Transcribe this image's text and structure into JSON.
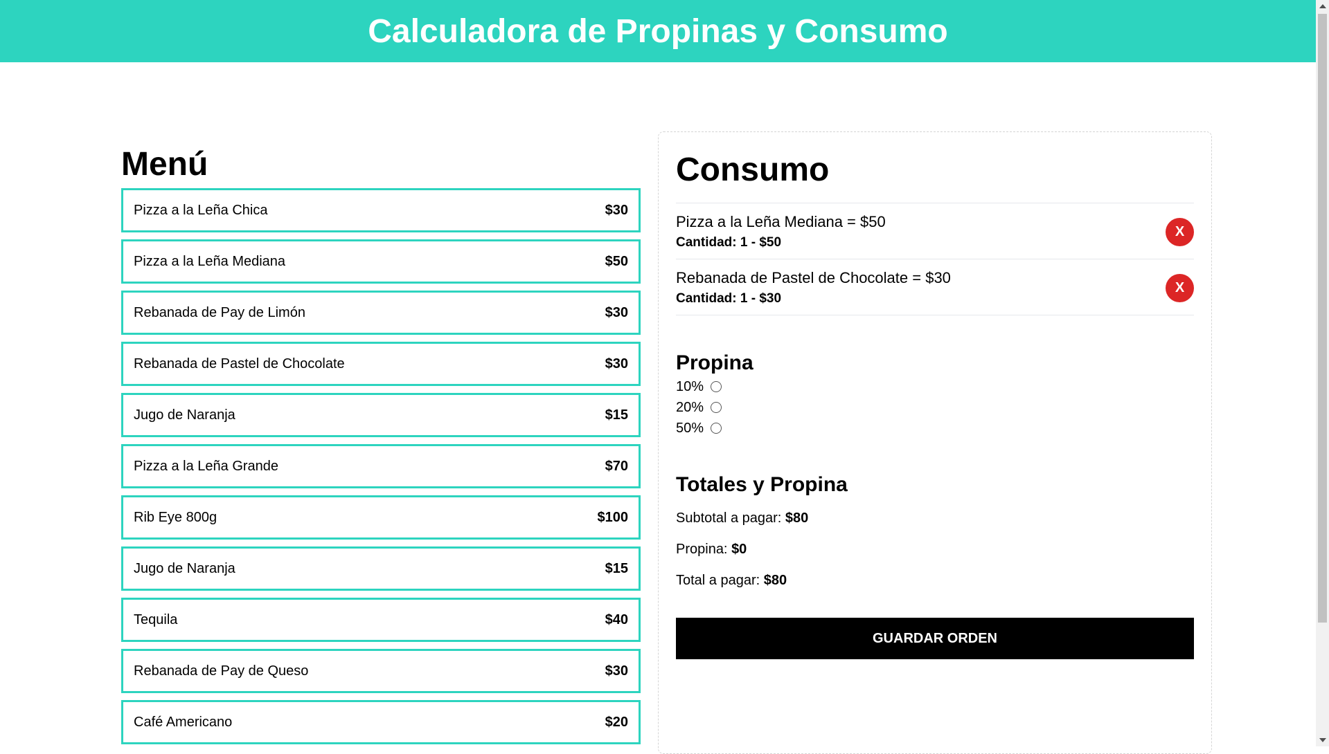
{
  "header": {
    "title": "Calculadora de Propinas y Consumo"
  },
  "menu": {
    "title": "Menú",
    "items": [
      {
        "name": "Pizza a la Leña Chica",
        "price": "$30"
      },
      {
        "name": "Pizza a la Leña Mediana",
        "price": "$50"
      },
      {
        "name": "Rebanada de Pay de Limón",
        "price": "$30"
      },
      {
        "name": "Rebanada de Pastel de Chocolate",
        "price": "$30"
      },
      {
        "name": "Jugo de Naranja",
        "price": "$15"
      },
      {
        "name": "Pizza a la Leña Grande",
        "price": "$70"
      },
      {
        "name": "Rib Eye 800g",
        "price": "$100"
      },
      {
        "name": "Jugo de Naranja",
        "price": "$15"
      },
      {
        "name": "Tequila",
        "price": "$40"
      },
      {
        "name": "Rebanada de Pay de Queso",
        "price": "$30"
      },
      {
        "name": "Café Americano",
        "price": "$20"
      }
    ]
  },
  "consumo": {
    "title": "Consumo",
    "items": [
      {
        "label": "Pizza a la Leña Mediana = $50",
        "quantity": "Cantidad: 1 - $50",
        "remove_label": "X"
      },
      {
        "label": "Rebanada de Pastel de Chocolate = $30",
        "quantity": "Cantidad: 1 - $30",
        "remove_label": "X"
      }
    ]
  },
  "propina": {
    "title": "Propina",
    "options": [
      {
        "label": "10%",
        "selected": false
      },
      {
        "label": "20%",
        "selected": false
      },
      {
        "label": "50%",
        "selected": false
      }
    ]
  },
  "totales": {
    "title": "Totales y Propina",
    "subtotal_label": "Subtotal a pagar:",
    "subtotal_value": "$80",
    "tip_label": "Propina:",
    "tip_value": "$0",
    "total_label": "Total a pagar:",
    "total_value": "$80"
  },
  "actions": {
    "save_label": "GUARDAR ORDEN"
  },
  "colors": {
    "accent": "#2dd4bf",
    "remove": "#dc2626",
    "button": "#000000"
  }
}
